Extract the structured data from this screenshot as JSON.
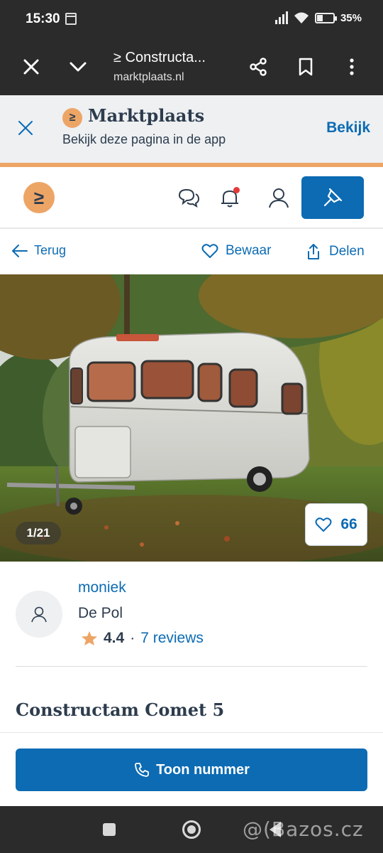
{
  "status_bar": {
    "time": "15:30",
    "battery": "35%"
  },
  "browser": {
    "title": "≥ Constructa...",
    "url": "marktplaats.nl"
  },
  "app_banner": {
    "brand": "Marktplaats",
    "subtitle": "Bekijk deze pagina in de app",
    "open_label": "Bekijk"
  },
  "site_header": {
    "logo_glyph": "≥"
  },
  "actions": {
    "back_label": "Terug",
    "save_label": "Bewaar",
    "share_label": "Delen"
  },
  "photo": {
    "counter": "1/21",
    "favorites": "66"
  },
  "seller": {
    "name": "moniek",
    "location": "De Pol",
    "rating": "4.4",
    "separator": "·",
    "reviews": "7 reviews"
  },
  "listing": {
    "title": "Constructam Comet 5"
  },
  "cta": {
    "label": "Toon nummer"
  },
  "watermark": "@(Bazos.cz",
  "colors": {
    "brand_blue": "#0c6bb3",
    "brand_orange": "#eda566",
    "text_dark": "#2d3c4d",
    "chrome_dark": "#2b2b2b"
  }
}
